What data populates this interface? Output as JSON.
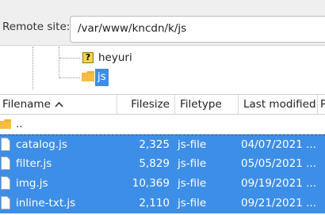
{
  "remote": {
    "label": "Remote site:",
    "path": "/var/www/kncdn/k/js"
  },
  "tree": {
    "items": [
      {
        "label": "heyuri",
        "icon": "question-folder-icon"
      },
      {
        "label": "js",
        "icon": "folder-icon",
        "selected": true
      }
    ]
  },
  "columns": {
    "filename": "Filename",
    "filesize": "Filesize",
    "filetype": "Filetype",
    "last_modified": "Last modified",
    "extra": "P"
  },
  "files": [
    {
      "name": "..",
      "size": "",
      "type": "",
      "modified": "",
      "kind": "parent"
    },
    {
      "name": "catalog.js",
      "size": "2,325",
      "type": "js-file",
      "modified": "04/07/2021 ...",
      "kind": "file",
      "selected": true
    },
    {
      "name": "filter.js",
      "size": "5,829",
      "type": "js-file",
      "modified": "05/05/2021 ...",
      "kind": "file",
      "selected": true
    },
    {
      "name": "img.js",
      "size": "10,369",
      "type": "js-file",
      "modified": "09/19/2021 ...",
      "kind": "file",
      "selected": true
    },
    {
      "name": "inline-txt.js",
      "size": "2,110",
      "type": "js-file",
      "modified": "09/21/2021 ...",
      "kind": "file",
      "selected": true
    }
  ],
  "colors": {
    "selection": "#3d8ee6",
    "folder": "#f2b230"
  }
}
